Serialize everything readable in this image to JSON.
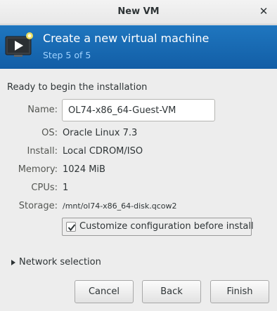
{
  "window": {
    "title": "New VM",
    "close_icon": "close-icon"
  },
  "banner": {
    "heading": "Create a new virtual machine",
    "step": "Step 5 of 5",
    "icon": "vm-monitor-play-icon",
    "colors": {
      "background": "#1a6cb5",
      "heading": "#ffffff",
      "step": "#9fd2ff"
    }
  },
  "summary": {
    "title": "Ready to begin the installation",
    "name_label": "Name:",
    "name_value": "OL74-x86_64-Guest-VM",
    "os_label": "OS:",
    "os_value": "Oracle Linux 7.3",
    "install_label": "Install:",
    "install_value": "Local CDROM/ISO",
    "memory_label": "Memory:",
    "memory_value": "1024 MiB",
    "cpus_label": "CPUs:",
    "cpus_value": "1",
    "storage_label": "Storage:",
    "storage_value": "/mnt/ol74-x86_64-disk.qcow2"
  },
  "customize": {
    "label": "Customize configuration before install",
    "checked": true
  },
  "network": {
    "label": "Network selection",
    "expanded": false
  },
  "buttons": {
    "cancel": "Cancel",
    "back": "Back",
    "finish": "Finish"
  }
}
